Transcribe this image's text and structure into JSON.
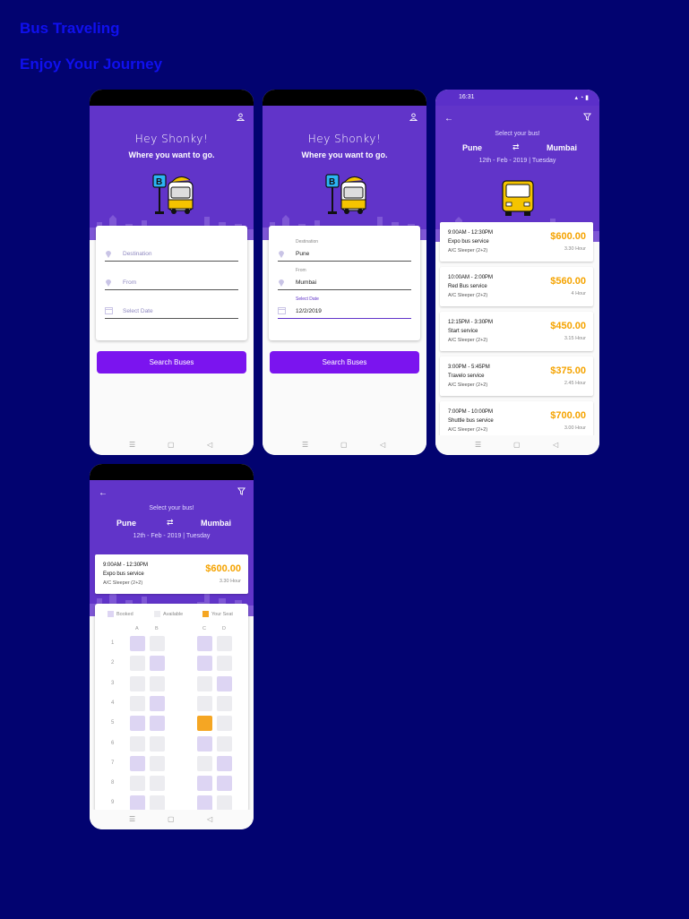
{
  "page": {
    "title": "Bus Traveling",
    "subtitle": "Enjoy Your Journey"
  },
  "colors": {
    "background": "#020370",
    "header_text": "#1010ee",
    "primary_purple": "#6134c9",
    "button": "#7b14ef",
    "price": "#f5a300",
    "your_seat": "#f5a623"
  },
  "screen1": {
    "greeting": "Hey Shonky!",
    "prompt": "Where you want to go.",
    "destination_placeholder": "Destination",
    "from_placeholder": "From",
    "date_placeholder": "Select Date",
    "search_label": "Search Buses"
  },
  "screen2": {
    "greeting": "Hey Shonky!",
    "prompt": "Where you want to go.",
    "destination_label": "Destination",
    "destination_value": "Pune",
    "from_label": "From",
    "from_value": "Mumbai",
    "date_label": "Select Date",
    "date_value": "12/2/2019",
    "search_label": "Search Buses"
  },
  "screen3": {
    "status_time": "16:31",
    "heading": "Select your bus!",
    "from_city": "Pune",
    "to_city": "Mumbai",
    "date": "12th - Feb - 2019 | Tuesday",
    "buses": [
      {
        "time": "9:00AM - 12:30PM",
        "name": "Expo bus service",
        "type": "A/C Sleeper (2+2)",
        "price": "$600.00",
        "duration": "3.30 Hour"
      },
      {
        "time": "10:00AM - 2:00PM",
        "name": "Red Bus service",
        "type": "A/C Sleeper (2+2)",
        "price": "$560.00",
        "duration": "4 Hour"
      },
      {
        "time": "12:15PM - 3:30PM",
        "name": "Start service",
        "type": "A/C Sleeper (2+2)",
        "price": "$450.00",
        "duration": "3.15 Hour"
      },
      {
        "time": "3:00PM - 5:45PM",
        "name": "Travelo service",
        "type": "A/C Sleeper (2+2)",
        "price": "$375.00",
        "duration": "2.45 Hour"
      },
      {
        "time": "7:00PM - 10:00PM",
        "name": "Shuttle bus service",
        "type": "A/C Sleeper (2+2)",
        "price": "$700.00",
        "duration": "3.00 Hour"
      }
    ]
  },
  "screen4": {
    "heading": "Select your bus!",
    "from_city": "Pune",
    "to_city": "Mumbai",
    "date": "12th - Feb - 2019 | Tuesday",
    "bus": {
      "time": "9:00AM - 12:30PM",
      "name": "Expo bus service",
      "type": "A/C Sleeper (2+2)",
      "price": "$600.00",
      "duration": "3.30 Hour"
    },
    "legend": {
      "booked": "Booked",
      "available": "Available",
      "yours": "Your Seat"
    },
    "columns": [
      "A",
      "B",
      "C",
      "D"
    ],
    "rows": [
      {
        "n": "1",
        "seats": [
          "booked",
          "avail",
          "booked",
          "avail"
        ]
      },
      {
        "n": "2",
        "seats": [
          "avail",
          "booked",
          "booked",
          "avail"
        ]
      },
      {
        "n": "3",
        "seats": [
          "avail",
          "avail",
          "avail",
          "booked"
        ]
      },
      {
        "n": "4",
        "seats": [
          "avail",
          "booked",
          "avail",
          "avail"
        ]
      },
      {
        "n": "5",
        "seats": [
          "booked",
          "booked",
          "yours",
          "avail"
        ]
      },
      {
        "n": "6",
        "seats": [
          "avail",
          "avail",
          "booked",
          "avail"
        ]
      },
      {
        "n": "7",
        "seats": [
          "booked",
          "avail",
          "avail",
          "booked"
        ]
      },
      {
        "n": "8",
        "seats": [
          "avail",
          "avail",
          "booked",
          "booked"
        ]
      },
      {
        "n": "9",
        "seats": [
          "booked",
          "avail",
          "booked",
          "avail"
        ]
      }
    ]
  }
}
